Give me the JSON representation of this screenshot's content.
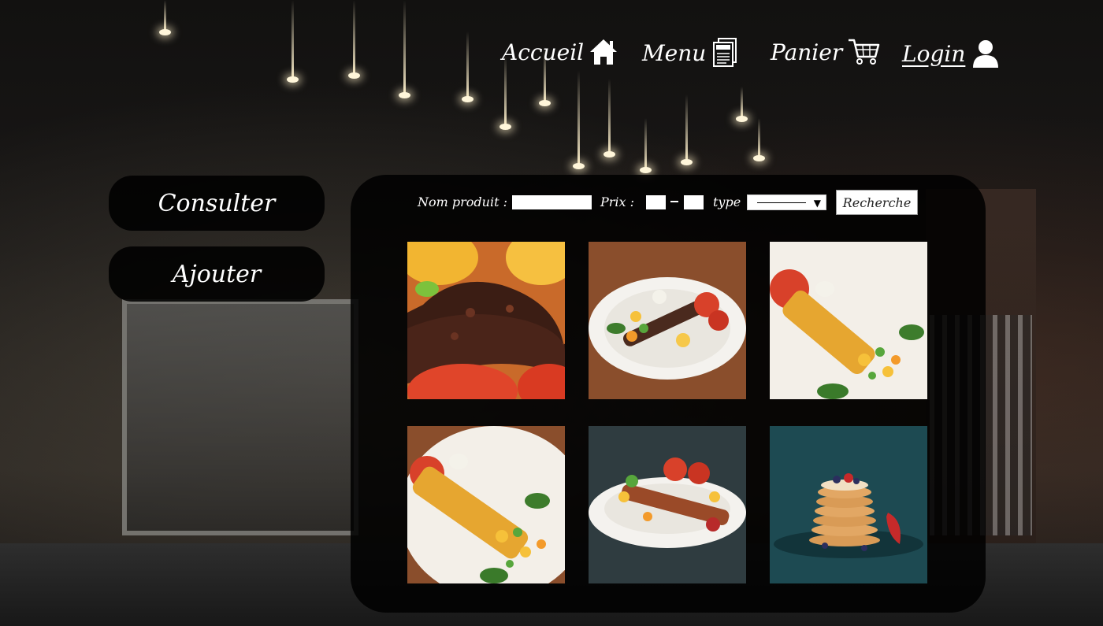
{
  "nav": {
    "items": [
      {
        "label": "Accueil",
        "icon": "home-icon"
      },
      {
        "label": "Menu",
        "icon": "menu-card-icon"
      },
      {
        "label": "Panier",
        "icon": "cart-icon"
      },
      {
        "label": "Login",
        "icon": "user-icon"
      }
    ]
  },
  "sidebar": {
    "consult_label": "Consulter",
    "add_label": "Ajouter"
  },
  "search": {
    "name_label": "Nom produit :",
    "name_value": "",
    "price_label": "Prix :",
    "price_min": "",
    "price_max": "",
    "separator": "–",
    "type_label": "type",
    "type_selected": "-----------",
    "button_label": "Recherche"
  },
  "products": [
    {
      "name": "grilled-kebab-closeup-image"
    },
    {
      "name": "kebab-plate-brown-image"
    },
    {
      "name": "chicken-skewer-plate-image"
    },
    {
      "name": "chicken-skewer-plate-2-image"
    },
    {
      "name": "chicken-plate-dark-image"
    },
    {
      "name": "pancakes-image"
    }
  ]
}
